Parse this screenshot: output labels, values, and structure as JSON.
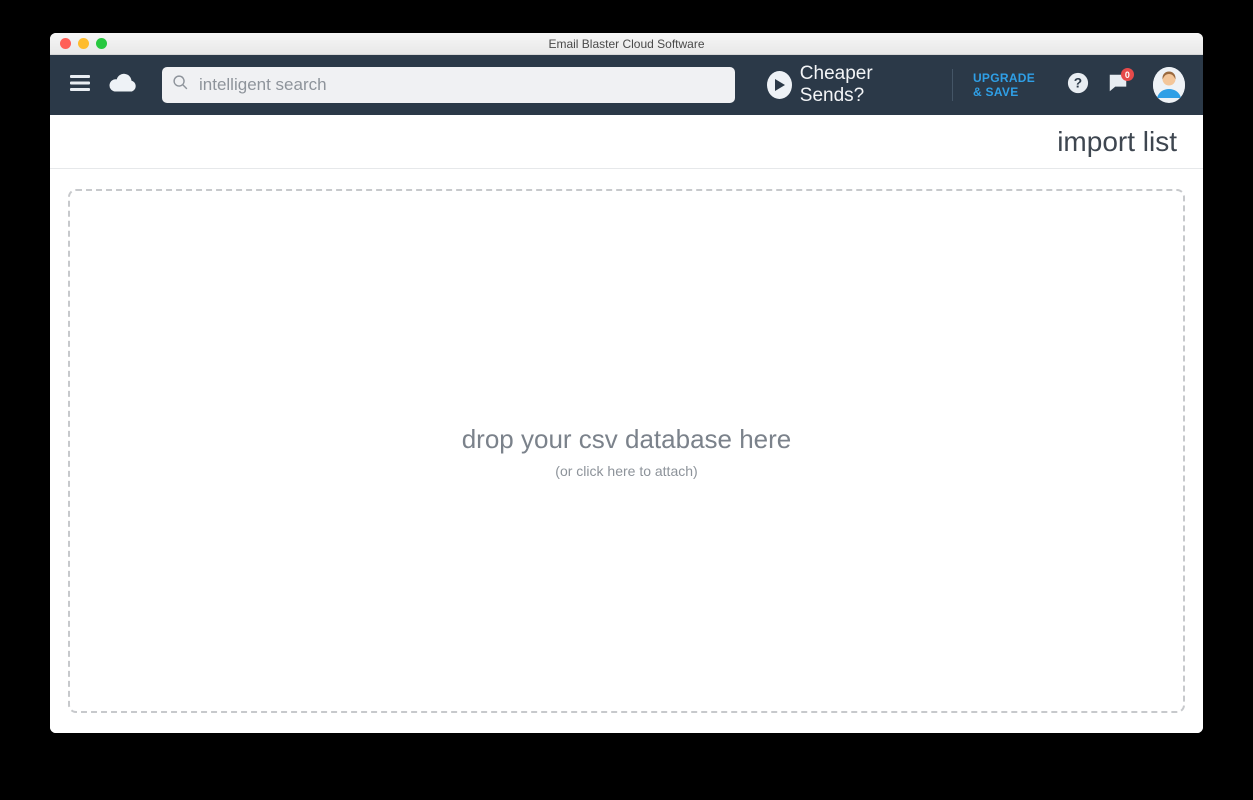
{
  "window": {
    "title": "Email Blaster Cloud Software"
  },
  "topbar": {
    "search_placeholder": "intelligent search",
    "cheaper_label": "Cheaper Sends?",
    "upgrade_line1": "UPGRADE",
    "upgrade_line2": "& SAVE",
    "notification_count": "0"
  },
  "subheader": {
    "title": "import list"
  },
  "dropzone": {
    "primary": "drop your csv database here",
    "secondary": "(or click here to attach)"
  }
}
